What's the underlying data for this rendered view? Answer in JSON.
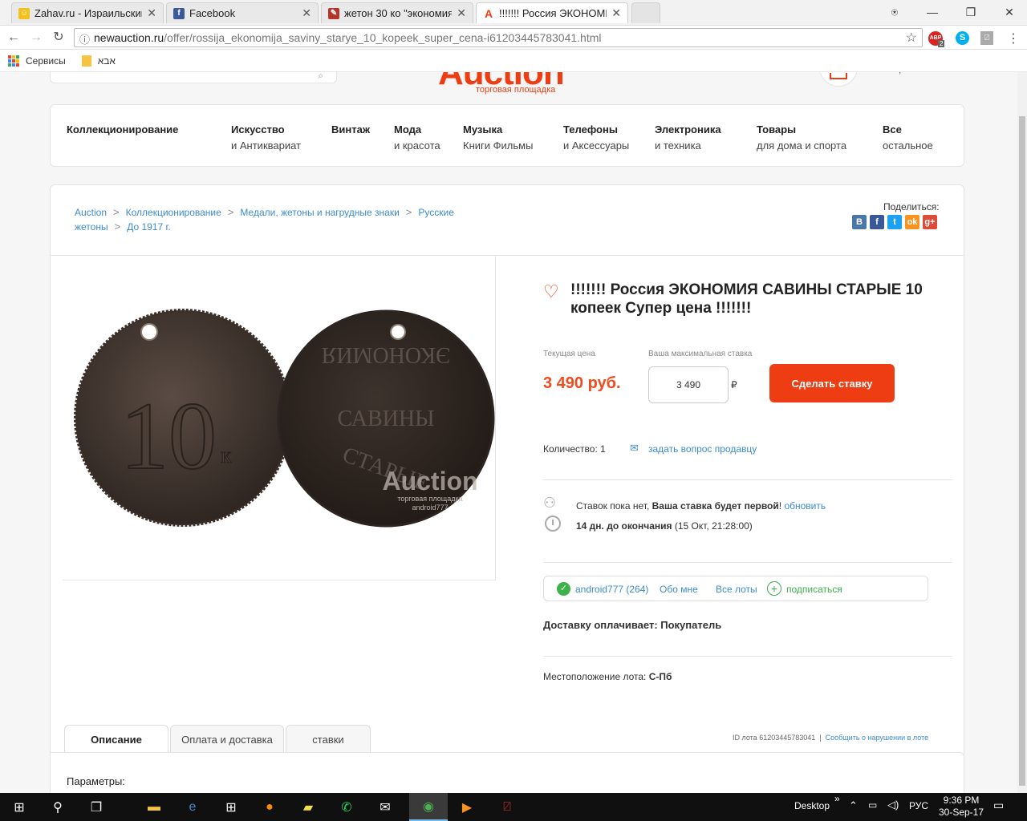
{
  "browser": {
    "tabs": [
      {
        "label": "Zahav.ru - Израильский",
        "favicon": "zahav-icon",
        "color": "#f4c11b"
      },
      {
        "label": "Facebook",
        "favicon": "facebook-icon",
        "color": "#3b5998"
      },
      {
        "label": "жетон 30 ко \"экономия",
        "favicon": "meshok-icon",
        "color": "#b5342b"
      },
      {
        "label": "!!!!!!! Россия ЭКОНОМИ",
        "favicon": "auction-icon",
        "color": "#ee3d12"
      }
    ],
    "url_host": "newauction.ru",
    "url_path": "/offer/rossija_ekonomija_saviny_starye_10_kopeek_super_cena-i61203445783041.html",
    "bookmarks": [
      "Сервисы",
      "אבא"
    ],
    "ext_badge": "2"
  },
  "site": {
    "logo": "Auction",
    "tagline": "торговая площадка",
    "categories": [
      {
        "title": "Коллекционирование",
        "sub": ""
      },
      {
        "title": "Искусство",
        "sub": "и Антиквариат"
      },
      {
        "title": "Винтаж",
        "sub": ""
      },
      {
        "title": "Мода",
        "sub": "и красота"
      },
      {
        "title": "Музыка",
        "sub": "Книги Фильмы"
      },
      {
        "title": "Телефоны",
        "sub": "и Аксессуары"
      },
      {
        "title": "Электроника",
        "sub": "и техника"
      },
      {
        "title": "Товары",
        "sub": "для дома и спорта"
      },
      {
        "title": "Все",
        "sub": "остальное"
      }
    ]
  },
  "breadcrumb": {
    "items": [
      "Auction",
      "Коллекционирование",
      "Медали, жетоны и нагрудные знаки",
      "Русские",
      "жетоны",
      "До 1917 г."
    ],
    "sep": ">"
  },
  "share": {
    "label": "Поделиться:",
    "buttons": [
      {
        "name": "vk",
        "text": "В",
        "color": "#4a76a8"
      },
      {
        "name": "facebook",
        "text": "f",
        "color": "#3b5998"
      },
      {
        "name": "twitter",
        "text": "t",
        "color": "#1da1f2"
      },
      {
        "name": "odnoklassniki",
        "text": "ok",
        "color": "#f7931e"
      },
      {
        "name": "googleplus",
        "text": "g+",
        "color": "#dd4b39"
      }
    ]
  },
  "coin": {
    "left_value": "10",
    "left_unit": "к",
    "right_top": "ЭКОНОМИЯ",
    "right_mid": "САВИНЫ",
    "right_bot": "СТАРЫЕ",
    "watermark": "Auction",
    "watermark_sub": "торговая площадка",
    "watermark_user": "android777"
  },
  "offer": {
    "title": "!!!!!!! Россия ЭКОНОМИЯ САВИНЫ СТАРЫЕ 10 копеек Супер цена !!!!!!!",
    "current_price_label": "Текущая цена",
    "current_price": "3 490 руб.",
    "max_bid_label": "Ваша максимальная ставка",
    "bid_value": "3 490",
    "currency": "₽",
    "bid_button": "Сделать ставку",
    "quantity_label": "Количество:",
    "quantity": "1",
    "ask_seller": "задать вопрос продавцу",
    "bids_text_1": "Ставок пока нет, ",
    "bids_text_bold": "Ваша ставка будет первой",
    "bids_text_2": "! ",
    "refresh": "обновить",
    "ends_bold": "14 дн. до окончания",
    "ends_date": " (15 Окт, 21:28:00)",
    "seller": "android777 (264)",
    "about": "Обо мне",
    "all_lots": "Все лоты",
    "subscribe": "подписаться",
    "delivery": "Доставку оплачивает: Покупатель",
    "location_label": "Местоположение лота: ",
    "location": "С-Пб"
  },
  "lower": {
    "tabs": [
      "Описание",
      "Оплата и доставка",
      "ставки"
    ],
    "lot_id": "ID лота 61203445783041",
    "report": "Сообщить о нарушении в лоте",
    "params": "Параметры:"
  },
  "taskbar": {
    "desktop": "Desktop",
    "lang": "РУС",
    "time": "9:36 PM",
    "date": "30-Sep-17"
  }
}
